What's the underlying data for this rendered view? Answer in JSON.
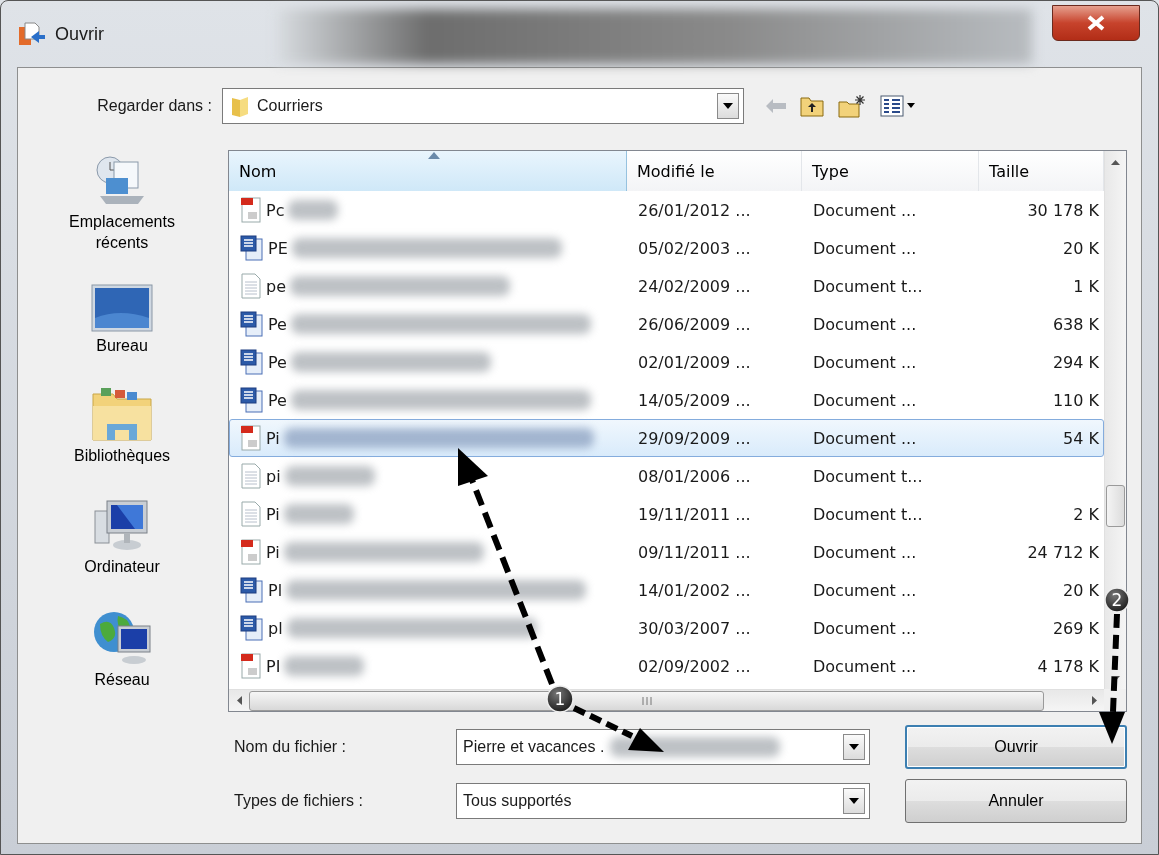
{
  "window": {
    "title": "Ouvrir"
  },
  "look_in": {
    "label": "Regarder dans :",
    "value": "Courriers"
  },
  "places": [
    {
      "label": "Emplacements récents",
      "kind": "recent"
    },
    {
      "label": "Bureau",
      "kind": "desktop"
    },
    {
      "label": "Bibliothèques",
      "kind": "libraries"
    },
    {
      "label": "Ordinateur",
      "kind": "computer"
    },
    {
      "label": "Réseau",
      "kind": "network"
    }
  ],
  "file_list": {
    "columns": [
      {
        "label": "Nom",
        "sorted": true
      },
      {
        "label": "Modifié le",
        "sorted": false
      },
      {
        "label": "Type",
        "sorted": false
      },
      {
        "label": "Taille",
        "sorted": false
      }
    ],
    "rows": [
      {
        "name": "Pc",
        "kind": "pdf",
        "modified": "26/01/2012 ...",
        "type": "Document ...",
        "size": "30 178 K",
        "selected": false
      },
      {
        "name": "PE",
        "kind": "word",
        "modified": "05/02/2003 ...",
        "type": "Document ...",
        "size": "20 K",
        "selected": false
      },
      {
        "name": "pe",
        "kind": "text",
        "modified": "24/02/2009 ...",
        "type": "Document t...",
        "size": "1 K",
        "selected": false
      },
      {
        "name": "Pe",
        "kind": "word",
        "modified": "26/06/2009 ...",
        "type": "Document ...",
        "size": "638 K",
        "selected": false
      },
      {
        "name": "Pe",
        "kind": "word",
        "modified": "02/01/2009 ...",
        "type": "Document ...",
        "size": "294 K",
        "selected": false
      },
      {
        "name": "Pe",
        "kind": "word",
        "modified": "14/05/2009 ...",
        "type": "Document ...",
        "size": "110 K",
        "selected": false
      },
      {
        "name": "Pi",
        "kind": "pdf",
        "modified": "29/09/2009 ...",
        "type": "Document ...",
        "size": "54 K",
        "selected": true
      },
      {
        "name": "pi",
        "kind": "text",
        "modified": "08/01/2006 ...",
        "type": "Document t...",
        "selected": false
      },
      {
        "name": "Pi",
        "kind": "text",
        "modified": "19/11/2011 ...",
        "type": "Document t...",
        "size": "2 K",
        "selected": false
      },
      {
        "name": "Pi",
        "kind": "pdf",
        "modified": "09/11/2011 ...",
        "type": "Document ...",
        "size": "24 712 K",
        "selected": false
      },
      {
        "name": "Pl",
        "kind": "word",
        "modified": "14/01/2002 ...",
        "type": "Document ...",
        "size": "20 K",
        "selected": false
      },
      {
        "name": "pl",
        "kind": "word",
        "modified": "30/03/2007 ...",
        "type": "Document ...",
        "size": "269 K",
        "selected": false
      },
      {
        "name": "PI",
        "kind": "pdf",
        "modified": "02/09/2002 ...",
        "type": "Document ...",
        "size": "4 178 K",
        "selected": false
      }
    ]
  },
  "file_name": {
    "label": "Nom du fichier :",
    "value": "Pierre et vacances ."
  },
  "file_type": {
    "label": "Types de fichiers :",
    "value": "Tous supportés"
  },
  "buttons": [
    {
      "label": "Ouvrir",
      "default": true
    },
    {
      "label": "Annuler",
      "default": false
    }
  ],
  "annotations": [
    {
      "label": "1"
    },
    {
      "label": "2"
    }
  ]
}
